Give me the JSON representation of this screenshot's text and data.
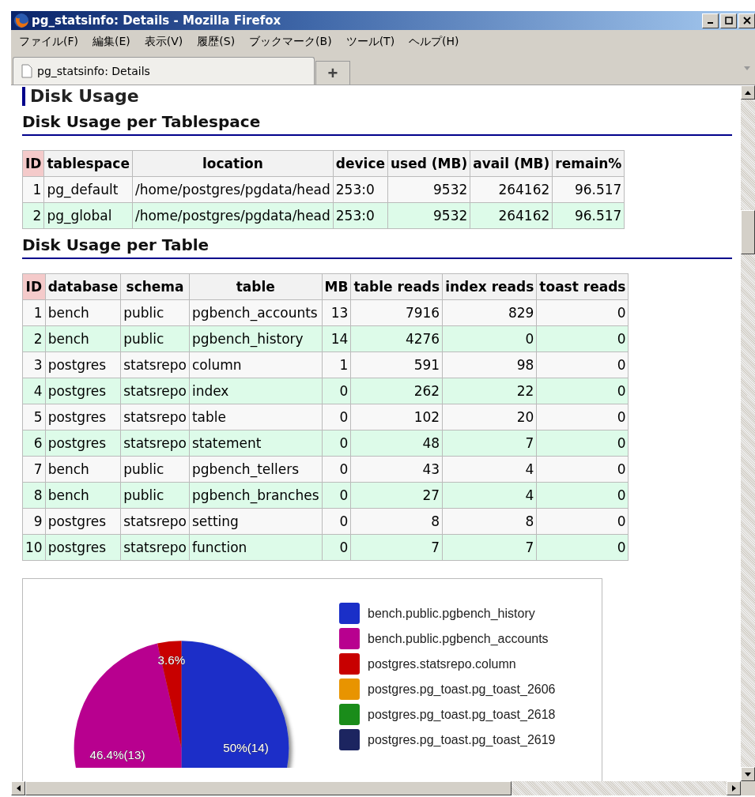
{
  "window": {
    "title": "pg_statsinfo: Details - Mozilla Firefox"
  },
  "menu": [
    "ファイル(F)",
    "編集(E)",
    "表示(V)",
    "履歴(S)",
    "ブックマーク(B)",
    "ツール(T)",
    "ヘルプ(H)"
  ],
  "tabs": [
    {
      "label": "pg_statsinfo: Details",
      "selected": true
    }
  ],
  "new_tab": "+",
  "page_heading": "Disk Usage",
  "tablespace_section": {
    "heading": "Disk Usage per Tablespace",
    "columns": [
      "ID",
      "tablespace",
      "location",
      "device",
      "used (MB)",
      "avail (MB)",
      "remain%"
    ],
    "rows": [
      [
        "1",
        "pg_default",
        "/home/postgres/pgdata/head",
        "253:0",
        "9532",
        "264162",
        "96.517"
      ],
      [
        "2",
        "pg_global",
        "/home/postgres/pgdata/head",
        "253:0",
        "9532",
        "264162",
        "96.517"
      ]
    ]
  },
  "table_section": {
    "heading": "Disk Usage per Table",
    "columns": [
      "ID",
      "database",
      "schema",
      "table",
      "MB",
      "table reads",
      "index reads",
      "toast reads"
    ],
    "rows": [
      [
        "1",
        "bench",
        "public",
        "pgbench_accounts",
        "13",
        "7916",
        "829",
        "0"
      ],
      [
        "2",
        "bench",
        "public",
        "pgbench_history",
        "14",
        "4276",
        "0",
        "0"
      ],
      [
        "3",
        "postgres",
        "statsrepo",
        "column",
        "1",
        "591",
        "98",
        "0"
      ],
      [
        "4",
        "postgres",
        "statsrepo",
        "index",
        "0",
        "262",
        "22",
        "0"
      ],
      [
        "5",
        "postgres",
        "statsrepo",
        "table",
        "0",
        "102",
        "20",
        "0"
      ],
      [
        "6",
        "postgres",
        "statsrepo",
        "statement",
        "0",
        "48",
        "7",
        "0"
      ],
      [
        "7",
        "bench",
        "public",
        "pgbench_tellers",
        "0",
        "43",
        "4",
        "0"
      ],
      [
        "8",
        "bench",
        "public",
        "pgbench_branches",
        "0",
        "27",
        "4",
        "0"
      ],
      [
        "9",
        "postgres",
        "statsrepo",
        "setting",
        "0",
        "8",
        "8",
        "0"
      ],
      [
        "10",
        "postgres",
        "statsrepo",
        "function",
        "0",
        "7",
        "7",
        "0"
      ]
    ],
    "chart_data": {
      "type": "pie",
      "categories": [
        "bench.public.pgbench_history",
        "bench.public.pgbench_accounts",
        "postgres.statsrepo.column",
        "postgres.pg_toast.pg_toast_2606",
        "postgres.pg_toast.pg_toast_2618",
        "postgres.pg_toast.pg_toast_2619"
      ],
      "values": [
        50,
        46.4,
        3.6,
        0,
        0,
        0
      ],
      "colors": [
        "#1a2fc8",
        "#b8008f",
        "#c80000",
        "#e89400",
        "#1a8c1a",
        "#1c2560"
      ],
      "legend": "right",
      "value_labels": [
        "50%(14)",
        "46.4%(13)",
        "3.6%",
        null,
        null,
        null
      ]
    }
  }
}
